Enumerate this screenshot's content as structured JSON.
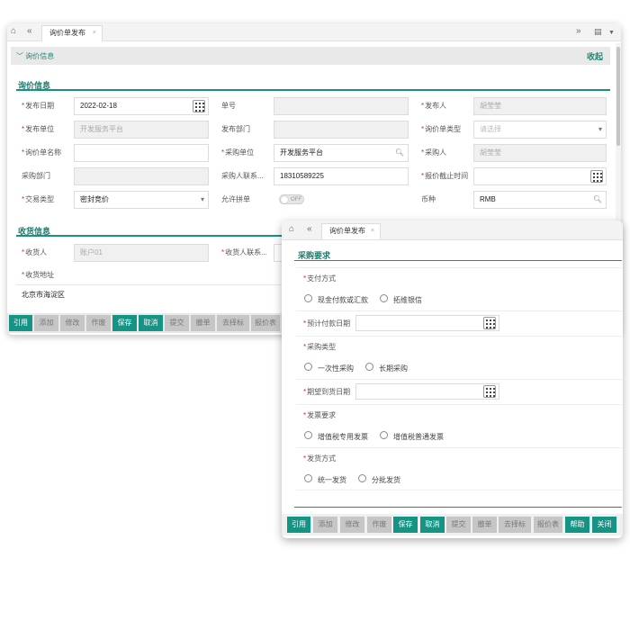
{
  "win1": {
    "tab_title": "询价单发布",
    "tab_close": "×",
    "collapse_title": "询价信息",
    "collapse_action": "收起",
    "section1_title": "询价信息",
    "section2_title": "收货信息",
    "fields": {
      "publish_date_label": "发布日期",
      "publish_date_value": "2022-02-18",
      "order_no_label": "单号",
      "publisher_label": "发布人",
      "publisher_value": "胡莹莹",
      "publish_unit_label": "发布单位",
      "publish_unit_value": "开发服务平台",
      "publish_dept_label": "发布部门",
      "inquiry_type_label": "询价单类型",
      "inquiry_type_placeholder": "请选择",
      "inquiry_name_label": "询价单名称",
      "purchase_unit_label": "采购单位",
      "purchase_unit_value": "开发服务平台",
      "purchaser_label": "采购人",
      "purchaser_value": "胡莹莹",
      "purchase_dept_label": "采购部门",
      "purchaser_contact_label": "采购人联系...",
      "purchaser_contact_value": "18310589225",
      "quote_deadline_label": "报价截止时间",
      "trade_type_label": "交易类型",
      "trade_type_value": "密封竞价",
      "allow_combine_label": "允许拼单",
      "allow_combine_state": "OFF",
      "currency_label": "币种",
      "currency_value": "RMB",
      "receiver_label": "收货人",
      "receiver_value": "账户01",
      "receiver_contact_label": "收货人联系...",
      "receive_address_label": "收货地址",
      "receive_address_value": "北京市海淀区"
    },
    "buttons": [
      "引用",
      "添加",
      "修改",
      "作废",
      "保存",
      "取消",
      "提交",
      "撤单",
      "去择标",
      "报价表"
    ]
  },
  "win2": {
    "tab_title": "询价单发布",
    "tab_close": "×",
    "section_title": "采购要求",
    "payment_label": "支付方式",
    "payment_options": [
      "现金付款或汇款",
      "拓维银信"
    ],
    "expected_pay_date_label": "预计付款日期",
    "purchase_type_label": "采购类型",
    "purchase_type_options": [
      "一次性采购",
      "长期采购"
    ],
    "expected_arrival_label": "期望到货日期",
    "invoice_label": "发票要求",
    "invoice_options": [
      "增值税专用发票",
      "增值税普通发票"
    ],
    "shipping_label": "发货方式",
    "shipping_options": [
      "统一发货",
      "分批发货"
    ],
    "buttons": [
      "引用",
      "添加",
      "修改",
      "作废",
      "保存",
      "取消",
      "提交",
      "撤单",
      "去择标",
      "报价表",
      "帮助",
      "关闭"
    ]
  },
  "colors": {
    "accent": "#159384",
    "required": "#d9302b",
    "disabled_btn": "#c6c6c6"
  },
  "icons": [
    "home-icon",
    "double-chevron-left-icon",
    "double-chevron-right-icon",
    "calendar-icon",
    "chevron-down-icon",
    "search-icon",
    "calendar-grid-icon"
  ]
}
